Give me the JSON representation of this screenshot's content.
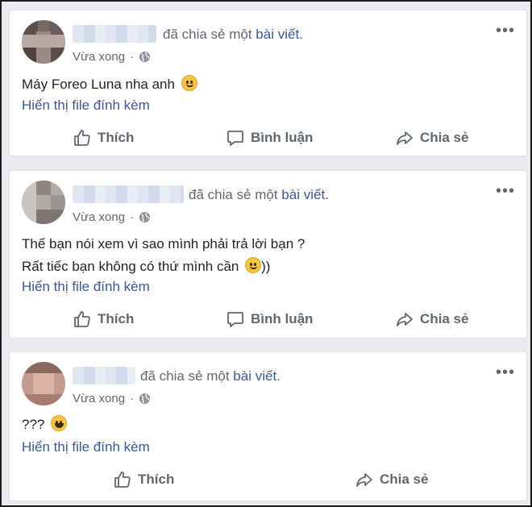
{
  "posts": [
    {
      "shared_text": "đã chia sẻ một",
      "shared_link": "bài viết.",
      "time": "Vừa xong",
      "message_lines": [
        "Máy Foreo Luna nha anh"
      ],
      "emoji": "slightly-smiling-face",
      "attachment_link": "Hiển thị file đính kèm",
      "actions": {
        "like": "Thích",
        "comment": "Bình luận",
        "share": "Chia sẻ"
      },
      "more_label": "•••"
    },
    {
      "shared_text": "đã chia sẻ một",
      "shared_link": "bài viết.",
      "time": "Vừa xong",
      "message_lines": [
        "Thế bạn nói xem vì sao mình phải trả lời bạn ?",
        "Rất tiếc bạn không có thứ mình cần",
        "))"
      ],
      "emoji": "slightly-smiling-face",
      "attachment_link": "Hiển thị file đính kèm",
      "actions": {
        "like": "Thích",
        "comment": "Bình luận",
        "share": "Chia sẻ"
      },
      "more_label": "•••"
    },
    {
      "shared_text": "đã chia sẻ một",
      "shared_link": "bài viết.",
      "time": "Vừa xong",
      "message_lines": [
        "???"
      ],
      "emoji": "grinning-face",
      "attachment_link": "Hiển thị file đính kèm",
      "actions": {
        "like": "Thích",
        "share": "Chia sẻ"
      },
      "more_label": "•••"
    }
  ],
  "colors": {
    "link": "#385898",
    "meta": "#616770",
    "action": "#606770",
    "background": "#e9ebee"
  }
}
